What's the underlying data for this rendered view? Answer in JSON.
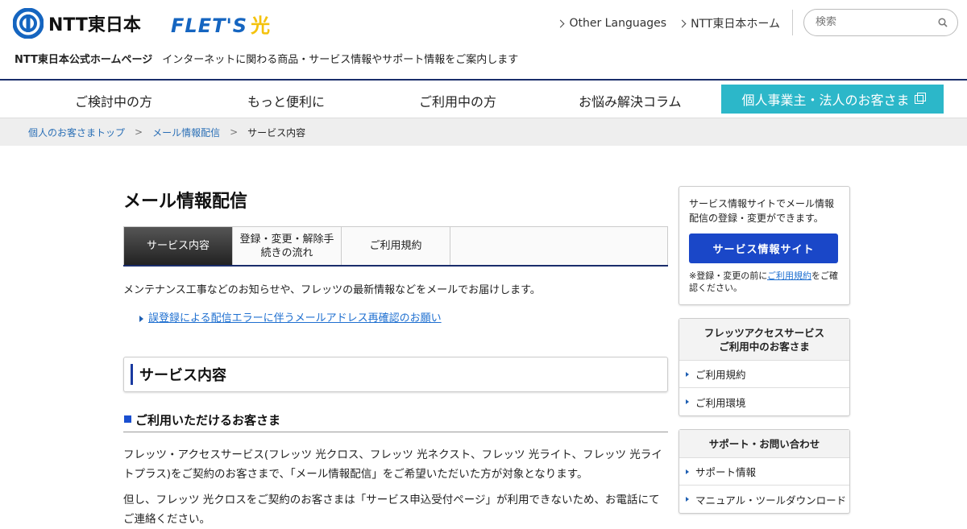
{
  "header": {
    "brand": "NTT東日本",
    "service_logo": "FLET'S",
    "service_logo_hikari": "光",
    "links": [
      {
        "label": "Other Languages"
      },
      {
        "label": "NTT東日本ホーム"
      }
    ],
    "search_placeholder": "検索",
    "tagline_strong": "NTT東日本公式ホームページ",
    "tagline": "インターネットに関わる商品・サービス情報やサポート情報をご案内します"
  },
  "gnav": {
    "items": [
      {
        "label": "ご検討中の方"
      },
      {
        "label": "もっと便利に"
      },
      {
        "label": "ご利用中の方"
      },
      {
        "label": "お悩み解決コラム"
      }
    ],
    "biz_label": "個人事業主・法人のお客さま"
  },
  "breadcrumb": {
    "items": [
      {
        "label": "個人のお客さまトップ"
      },
      {
        "label": "メール情報配信"
      }
    ],
    "current": "サービス内容"
  },
  "main": {
    "title": "メール情報配信",
    "tabs": [
      {
        "label": "サービス内容"
      },
      {
        "label_1": "登録・変更・解除手",
        "label_2": "続きの流れ"
      },
      {
        "label": "ご利用規約"
      }
    ],
    "intro": "メンテナンス工事などのお知らせや、フレッツの最新情報などをメールでお届けします。",
    "notice_link": "誤登録による配信エラーに伴うメールアドレス再確認のお願い",
    "section_title": "サービス内容",
    "sub_title": "ご利用いただけるお客さま",
    "paragraph_1": "フレッツ・アクセスサービス(フレッツ 光クロス、フレッツ 光ネクスト、フレッツ 光ライト、フレッツ 光ライトプラス)をご契約のお客さまで、「メール情報配信」をご希望いただいた方が対象となります。",
    "paragraph_2": "但し、フレッツ 光クロスをご契約のお客さまは「サービス申込受付ページ」が利用できないため、お電話にてご連絡ください。"
  },
  "sidebar": {
    "promo_text": "サービス情報サイトでメール情報配信の登録・変更ができます。",
    "promo_button": "サービス情報サイト",
    "promo_note_prefix": "※登録・変更の前に",
    "promo_note_link": "ご利用規約",
    "promo_note_suffix": "をご確認ください。",
    "menus": [
      {
        "title_1": "フレッツアクセスサービス",
        "title_2": "ご利用中のお客さま",
        "items": [
          {
            "label": "ご利用規約"
          },
          {
            "label": "ご利用環境"
          }
        ]
      },
      {
        "title_1": "サポート・お問い合わせ",
        "items": [
          {
            "label": "サポート情報"
          },
          {
            "label": "マニュアル・ツールダウンロード"
          }
        ]
      }
    ]
  },
  "colors": {
    "navy": "#1a2d6b",
    "biz_button": "#2cb7c9",
    "promo_button": "#1a47c8",
    "link": "#1e6fd0"
  }
}
